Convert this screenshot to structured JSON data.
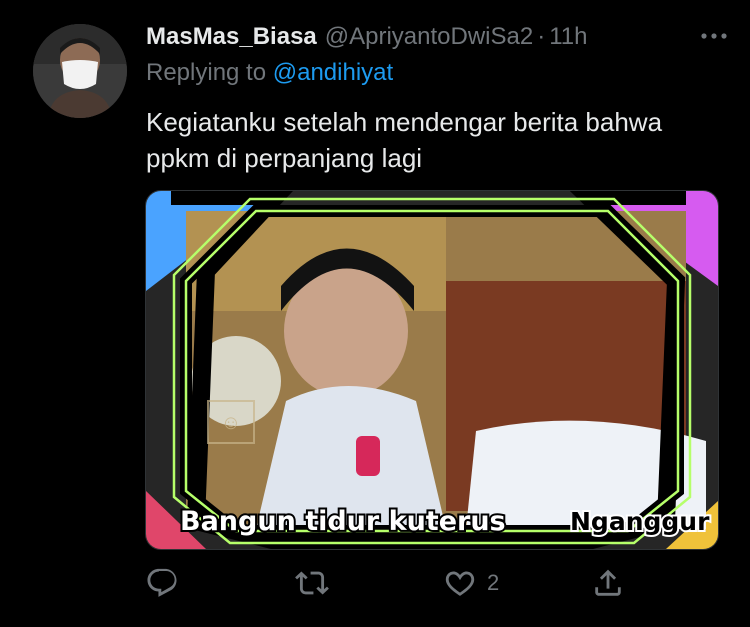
{
  "tweet": {
    "author_name": "MasMas_Biasa",
    "author_handle": "@ApriyantoDwiSa2",
    "separator": "·",
    "time": "11h",
    "replying_prefix": "Replying to ",
    "replying_to": "@andihiyat",
    "body": "Kegiatanku setelah mendengar berita bahwa ppkm di perpanjang lagi",
    "media": {
      "caption_part1": "Bangun tidur kuterus",
      "caption_part2": "Nganggur"
    }
  },
  "actions": {
    "reply_icon": "reply-icon",
    "retweet_icon": "retweet-icon",
    "like_icon": "heart-icon",
    "like_count": "2",
    "share_icon": "share-icon"
  },
  "colors": {
    "background": "#000000",
    "text": "#e7e9ea",
    "secondary": "#71767b",
    "link": "#1d9bf0"
  }
}
